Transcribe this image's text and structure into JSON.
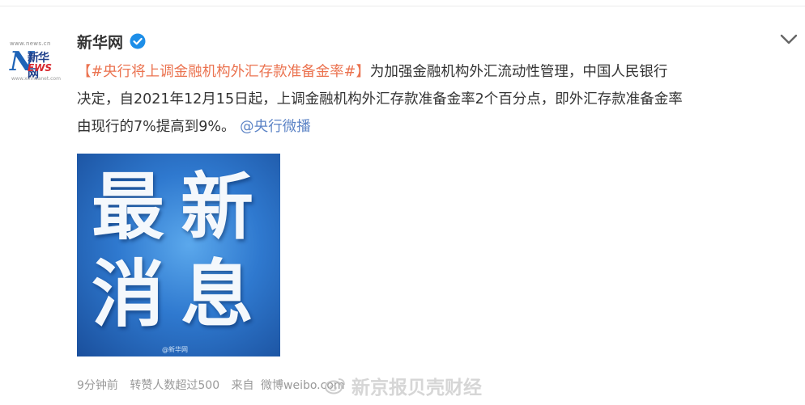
{
  "author": {
    "name": "新华网",
    "avatar": {
      "site_text": "www.news.cn",
      "letter": "N",
      "cn_text": "新华网",
      "ews_text": "EWS",
      "url_text": "www.xinhuanet.com"
    }
  },
  "post": {
    "hashtag": "【#央行将上调金融机构外汇存款准备金率#】",
    "line1_rest": "为加强金融机构外汇流动性管理，中国人民银行",
    "line2": "决定，自2021年12月15日起，上调金融机构外汇存款准备金率2个百分点，即外汇存款准备金率",
    "line3": "由现行的7%提高到9%。",
    "mention": "@央行微播"
  },
  "image": {
    "words": [
      "最",
      "新",
      "消",
      "息"
    ],
    "watermark": "@新华网"
  },
  "meta": {
    "time": "9分钟前",
    "reposts": "转赞人数超过500",
    "source_prefix": "来自",
    "source": "微博weibo.com"
  },
  "watermark": {
    "text": "新京报贝壳财经"
  },
  "colors": {
    "hashtag": "#eb7350",
    "mention": "#5d84c6",
    "verified": "#1d8ee8",
    "image_bg": "#2f79cf"
  }
}
